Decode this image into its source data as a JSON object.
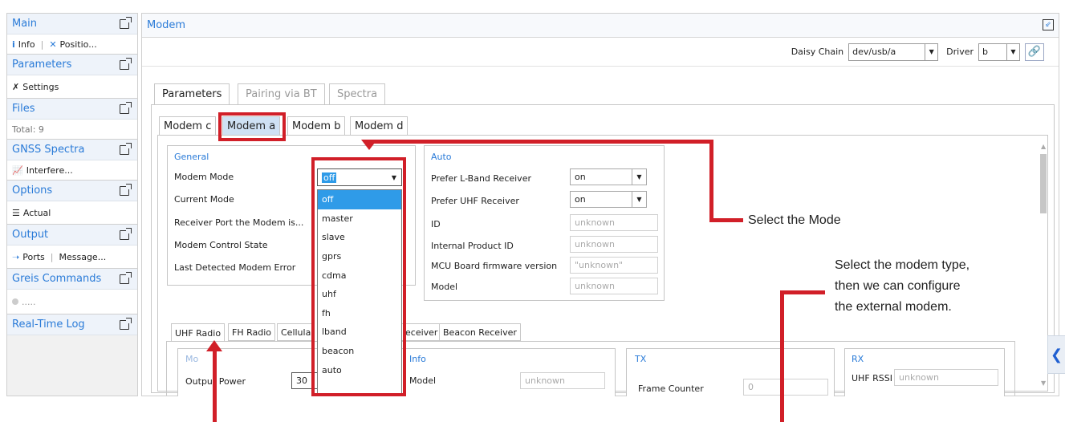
{
  "sidebar": {
    "sections": [
      {
        "title": "Main",
        "sub": [
          {
            "icon": "info-icon",
            "text": "Info"
          },
          {
            "icon": "satellite-icon",
            "text": "Positio..."
          }
        ]
      },
      {
        "title": "Parameters",
        "sub": [
          {
            "icon": "wrench-icon",
            "text": "Settings"
          }
        ]
      },
      {
        "title": "Files",
        "sub": [
          {
            "icon": "",
            "text": "Total: 9"
          }
        ]
      },
      {
        "title": "GNSS Spectra",
        "sub": [
          {
            "icon": "chart-icon",
            "text": "Interfere..."
          }
        ]
      },
      {
        "title": "Options",
        "sub": [
          {
            "icon": "list-icon",
            "text": "Actual"
          }
        ]
      },
      {
        "title": "Output",
        "sub": [
          {
            "icon": "arrow-icon",
            "text": "Ports"
          },
          {
            "icon": "",
            "text": "Message..."
          }
        ]
      },
      {
        "title": "Greis Commands",
        "sub": [
          {
            "icon": "radio-dot-icon",
            "text": "....."
          }
        ]
      },
      {
        "title": "Real-Time Log",
        "sub": []
      }
    ]
  },
  "main": {
    "title": "Modem",
    "daisy_chain_label": "Daisy Chain",
    "daisy_chain_value": "dev/usb/a",
    "driver_label": "Driver",
    "driver_value": "b",
    "tabs": [
      "Parameters",
      "Pairing via BT",
      "Spectra"
    ],
    "modem_tabs": [
      "Modem c",
      "Modem a",
      "Modem b",
      "Modem d"
    ],
    "general": {
      "title": "General",
      "rows": [
        "Modem Mode",
        "Current Mode",
        "Receiver Port the Modem is...",
        "Modem Control State",
        "Last Detected Modem Error"
      ],
      "mode_value": "off"
    },
    "mode_options": [
      "off",
      "master",
      "slave",
      "gprs",
      "cdma",
      "uhf",
      "fh",
      "lband",
      "beacon",
      "auto"
    ],
    "auto": {
      "title": "Auto",
      "rows": [
        {
          "label": "Prefer L-Band Receiver",
          "value": "on"
        },
        {
          "label": "Prefer UHF Receiver",
          "value": "on"
        },
        {
          "label": "ID",
          "value": "unknown"
        },
        {
          "label": "Internal Product ID",
          "value": "unknown"
        },
        {
          "label": "MCU Board firmware version",
          "value": "\"unknown\""
        },
        {
          "label": "Model",
          "value": "unknown"
        }
      ]
    },
    "bottom_tabs": [
      "UHF Radio",
      "FH Radio",
      "Cellula",
      "eceiver",
      "Beacon Receiver"
    ],
    "uhf": {
      "mode_title_partial": "Mo",
      "output_power_label": "Output Power",
      "output_power_value": "30",
      "info_title": "Info",
      "info_model_label": "Model",
      "info_model_value": "unknown",
      "tx_title": "TX",
      "frame_counter_label": "Frame Counter",
      "frame_counter_value": "0",
      "rx_title": "RX",
      "uhf_rssi_label": "UHF RSSI",
      "uhf_rssi_value": "unknown"
    }
  },
  "annotations": {
    "select_mode": "Select the Mode",
    "select_modem_type": [
      "Select the modem type,",
      "then we can configure",
      "the external modem."
    ]
  },
  "colors": {
    "accent": "#2a7bd8",
    "highlight": "#d11f28",
    "selected": "#2f9be8"
  }
}
